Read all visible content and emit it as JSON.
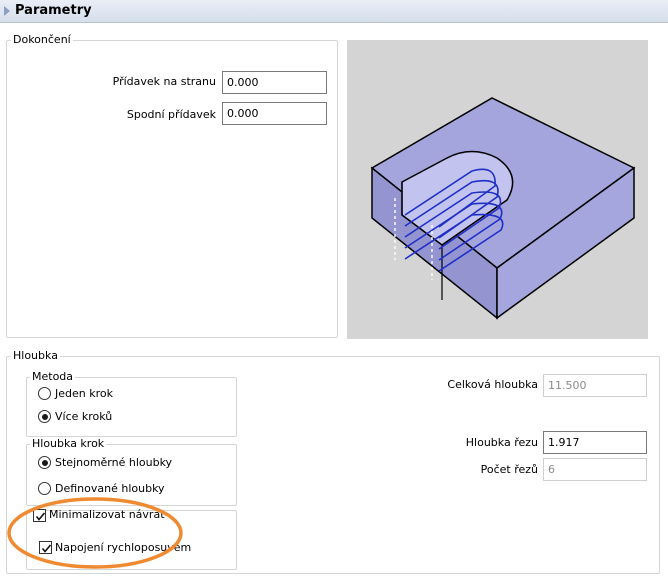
{
  "window": {
    "title": "Parametry"
  },
  "dokonceni": {
    "legend": "Dokončení",
    "pridavek_label": "Přídavek na stranu",
    "pridavek_value": "0.000",
    "spodni_label": "Spodní přídavek",
    "spodni_value": "0.000"
  },
  "hloubka": {
    "legend": "Hloubka",
    "metoda": {
      "legend": "Metoda",
      "jeden_krok": "Jeden krok",
      "vice_kroku": "Více kroků",
      "selected": "vice_kroku"
    },
    "hloubka_krok": {
      "legend": "Hloubka krok",
      "stejnomerne": "Stejnoměrné hloubky",
      "definovane": "Definované hloubky",
      "selected": "stejnomerne"
    },
    "minimalizovat_navrat": {
      "label": "Minimalizovat návrat",
      "checked": true
    },
    "napojeni_rychloposuvem": {
      "label": "Napojení rychloposuvem",
      "checked": true
    },
    "celkova_hloubka_label": "Celková hloubka",
    "celkova_hloubka_value": "11.500",
    "hloubka_rezu_label": "Hloubka řezu",
    "hloubka_rezu_value": "1.917",
    "pocet_rezu_label": "Počet řezů",
    "pocet_rezu_value": "6"
  },
  "colors": {
    "highlight_ellipse": "#f08a30",
    "part_fill": "#a4a5dd",
    "toolpath": "#1f2fc8",
    "preview_bg": "#d4d4d4"
  }
}
